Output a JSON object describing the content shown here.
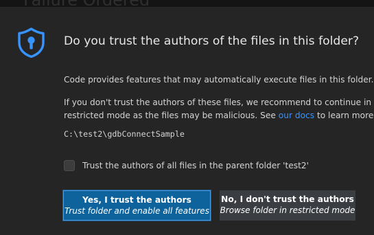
{
  "background": {
    "title": "Failure Ordered"
  },
  "dialog": {
    "icon": "shield-keyhole-icon",
    "title": "Do you trust the authors of the files in this folder?",
    "paragraph1": "Code provides features that may automatically execute files in this folder.",
    "paragraph2_line1": "If you don't trust the authors of these files, we recommend to continue in",
    "paragraph2_line2_before": "restricted mode as the files may be malicious. See ",
    "paragraph2_link": "our docs",
    "paragraph2_line2_after": " to learn more.",
    "folder_path": "C:\\test2\\gdbConnectSample",
    "checkbox": {
      "label": "Trust the authors of all files in the parent folder 'test2'",
      "checked": false
    },
    "buttons": {
      "trust": {
        "label": "Yes, I trust the authors",
        "sublabel": "Trust folder and enable all features"
      },
      "dont_trust": {
        "label": "No, I don't trust the authors",
        "sublabel": "Browse folder in restricted mode"
      }
    }
  },
  "colors": {
    "dialog_bg": "#252526",
    "accent": "#3794ff",
    "primary_button": "#0e639c",
    "secondary_button": "#3a3d41",
    "shield": "#3794ff"
  }
}
